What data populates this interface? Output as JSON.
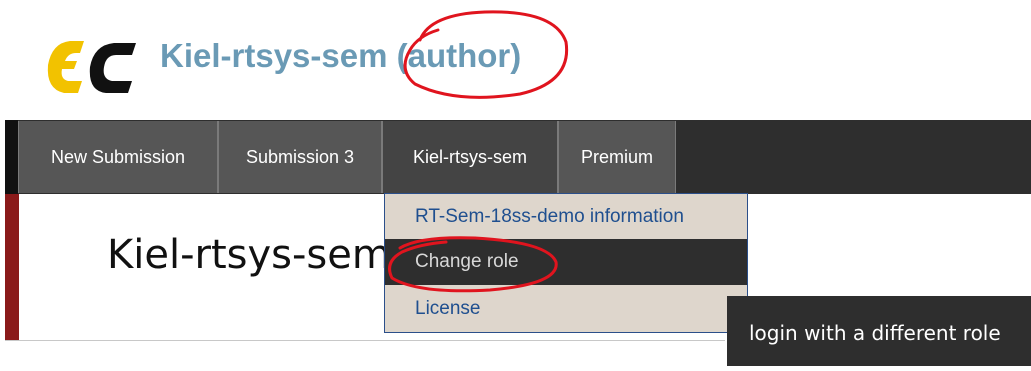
{
  "header": {
    "logo_icon": "ec-logo-icon",
    "title": "Kiel-rtsys-sem (author)",
    "title_color": "#6a9ab5"
  },
  "nav": {
    "items": [
      {
        "label": "New Submission"
      },
      {
        "label": "Submission 3"
      },
      {
        "label": "Kiel-rtsys-sem"
      },
      {
        "label": "Premium"
      }
    ]
  },
  "dropdown": {
    "items": [
      {
        "label": "RT-Sem-18ss-demo information"
      },
      {
        "label": "Change role"
      },
      {
        "label": "License"
      }
    ]
  },
  "main": {
    "heading": "Kiel-rtsys-sem"
  },
  "tooltip": {
    "text": "login with a different role"
  },
  "colors": {
    "annotation": "#e0141e",
    "logo_yellow": "#f2c200",
    "navbar": "#2e2e2e"
  }
}
